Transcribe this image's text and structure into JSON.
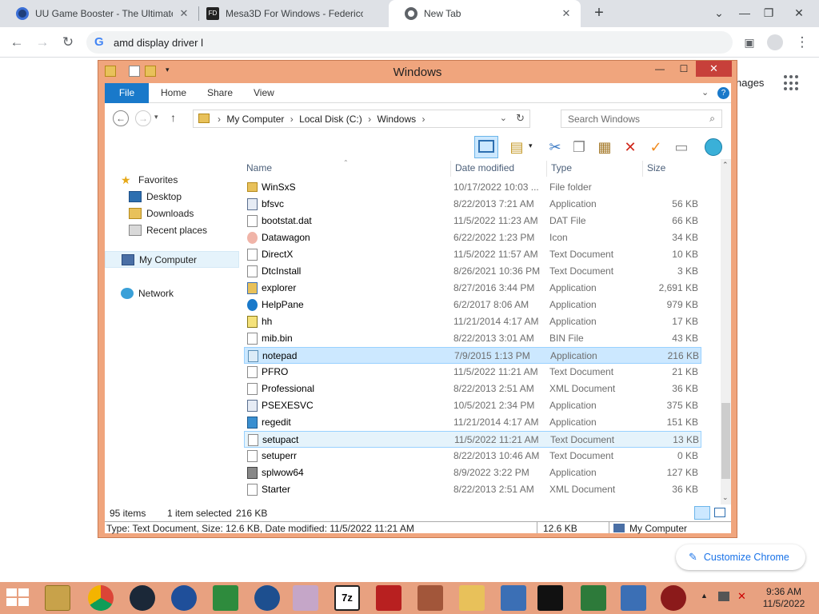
{
  "browser": {
    "tabs": [
      {
        "label": "UU Game Booster - The Ultimate",
        "active": false
      },
      {
        "label": "Mesa3D For Windows - Federico",
        "active": false
      },
      {
        "label": "New Tab",
        "active": true
      }
    ],
    "new_tab": "+",
    "omnibox_text": "amd display driver l",
    "omnibox_g": "G",
    "images_link": "nages",
    "customize_label": "Customize Chrome"
  },
  "explorer": {
    "title": "Windows",
    "ribbon_tabs": {
      "file": "File",
      "home": "Home",
      "share": "Share",
      "view": "View"
    },
    "address": {
      "crumb1": "My Computer",
      "crumb2": "Local Disk (C:)",
      "crumb3": "Windows"
    },
    "search_placeholder": "Search Windows",
    "nav": {
      "favorites": "Favorites",
      "desktop": "Desktop",
      "downloads": "Downloads",
      "recent": "Recent places",
      "my_computer": "My Computer",
      "network": "Network"
    },
    "columns": {
      "name": "Name",
      "date": "Date modified",
      "type": "Type",
      "size": "Size"
    },
    "files": [
      {
        "name": "WinSxS",
        "date": "10/17/2022 10:03 ...",
        "type": "File folder",
        "size": "",
        "icon": "folder"
      },
      {
        "name": "bfsvc",
        "date": "8/22/2013 7:21 AM",
        "type": "Application",
        "size": "56 KB",
        "icon": "app"
      },
      {
        "name": "bootstat.dat",
        "date": "11/5/2022 11:23 AM",
        "type": "DAT File",
        "size": "66 KB",
        "icon": "doc"
      },
      {
        "name": "Datawagon",
        "date": "6/22/2022 1:23 PM",
        "type": "Icon",
        "size": "34 KB",
        "icon": "iconfile"
      },
      {
        "name": "DirectX",
        "date": "11/5/2022 11:57 AM",
        "type": "Text Document",
        "size": "10 KB",
        "icon": "doc"
      },
      {
        "name": "DtcInstall",
        "date": "8/26/2021 10:36 PM",
        "type": "Text Document",
        "size": "3 KB",
        "icon": "doc"
      },
      {
        "name": "explorer",
        "date": "8/27/2016 3:44 PM",
        "type": "Application",
        "size": "2,691 KB",
        "icon": "explorer"
      },
      {
        "name": "HelpPane",
        "date": "6/2/2017 8:06 AM",
        "type": "Application",
        "size": "979 KB",
        "icon": "help"
      },
      {
        "name": "hh",
        "date": "11/21/2014 4:17 AM",
        "type": "Application",
        "size": "17 KB",
        "icon": "hh"
      },
      {
        "name": "mib.bin",
        "date": "8/22/2013 3:01 AM",
        "type": "BIN File",
        "size": "43 KB",
        "icon": "doc"
      },
      {
        "name": "notepad",
        "date": "7/9/2015 1:13 PM",
        "type": "Application",
        "size": "216 KB",
        "icon": "notepad",
        "selected": true
      },
      {
        "name": "PFRO",
        "date": "11/5/2022 11:21 AM",
        "type": "Text Document",
        "size": "21 KB",
        "icon": "doc"
      },
      {
        "name": "Professional",
        "date": "8/22/2013 2:51 AM",
        "type": "XML Document",
        "size": "36 KB",
        "icon": "doc"
      },
      {
        "name": "PSEXESVC",
        "date": "10/5/2021 2:34 PM",
        "type": "Application",
        "size": "375 KB",
        "icon": "app"
      },
      {
        "name": "regedit",
        "date": "11/21/2014 4:17 AM",
        "type": "Application",
        "size": "151 KB",
        "icon": "regedit"
      },
      {
        "name": "setupact",
        "date": "11/5/2022 11:21 AM",
        "type": "Text Document",
        "size": "13 KB",
        "icon": "doc",
        "hover": true
      },
      {
        "name": "setuperr",
        "date": "8/22/2013 10:46 AM",
        "type": "Text Document",
        "size": "0 KB",
        "icon": "doc"
      },
      {
        "name": "splwow64",
        "date": "8/9/2022 3:22 PM",
        "type": "Application",
        "size": "127 KB",
        "icon": "printer"
      },
      {
        "name": "Starter",
        "date": "8/22/2013 2:51 AM",
        "type": "XML Document",
        "size": "36 KB",
        "icon": "doc"
      }
    ],
    "status": {
      "items": "95 items",
      "selected": "1 item selected",
      "selected_size": "216 KB"
    },
    "details": {
      "text": "Type: Text Document, Size: 12.6 KB, Date modified: 11/5/2022 11:21 AM",
      "size": "12.6 KB",
      "location": "My Computer"
    }
  },
  "taskbar": {
    "time": "9:36 AM",
    "date": "11/5/2022",
    "accent": "#e8a180"
  }
}
